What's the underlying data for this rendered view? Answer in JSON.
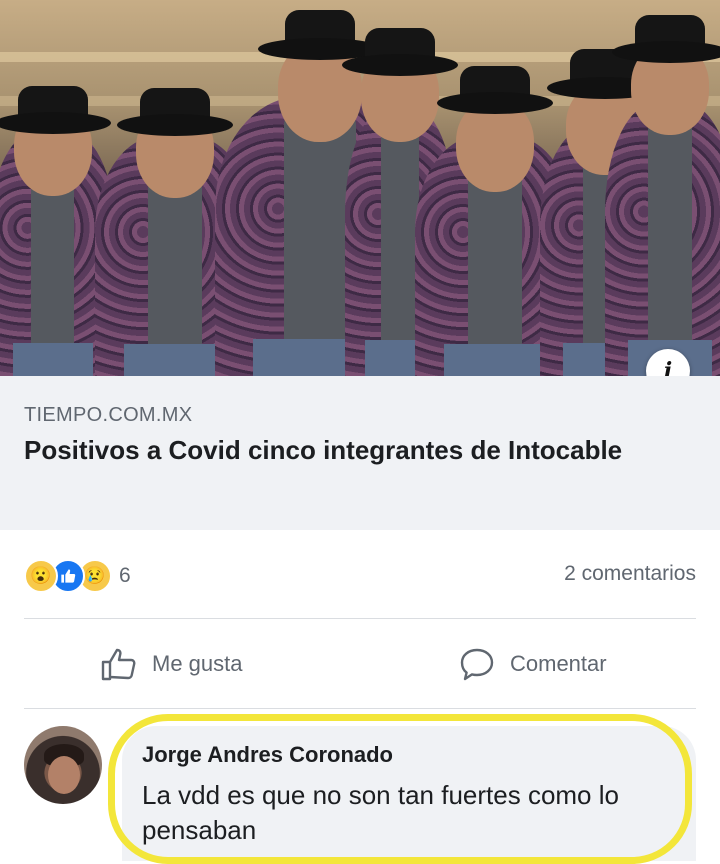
{
  "post": {
    "info_icon": "info-icon",
    "link": {
      "domain": "TIEMPO.COM.MX",
      "headline": "Positivos a Covid cinco integrantes de Intocable"
    }
  },
  "engagement": {
    "reactions": [
      "wow",
      "like",
      "sad"
    ],
    "reaction_count": "6",
    "comments_count": "2 comentarios"
  },
  "actions": {
    "like_label": "Me gusta",
    "comment_label": "Comentar"
  },
  "comment": {
    "author": "Jorge Andres Coronado",
    "text": "La vdd es que no son tan fuertes como lo pensaban"
  },
  "colors": {
    "background": "#ffffff",
    "link_box": "#f0f2f5",
    "secondary_text": "#606770",
    "like_blue": "#1877f2",
    "highlight_yellow": "#f3e63a"
  }
}
